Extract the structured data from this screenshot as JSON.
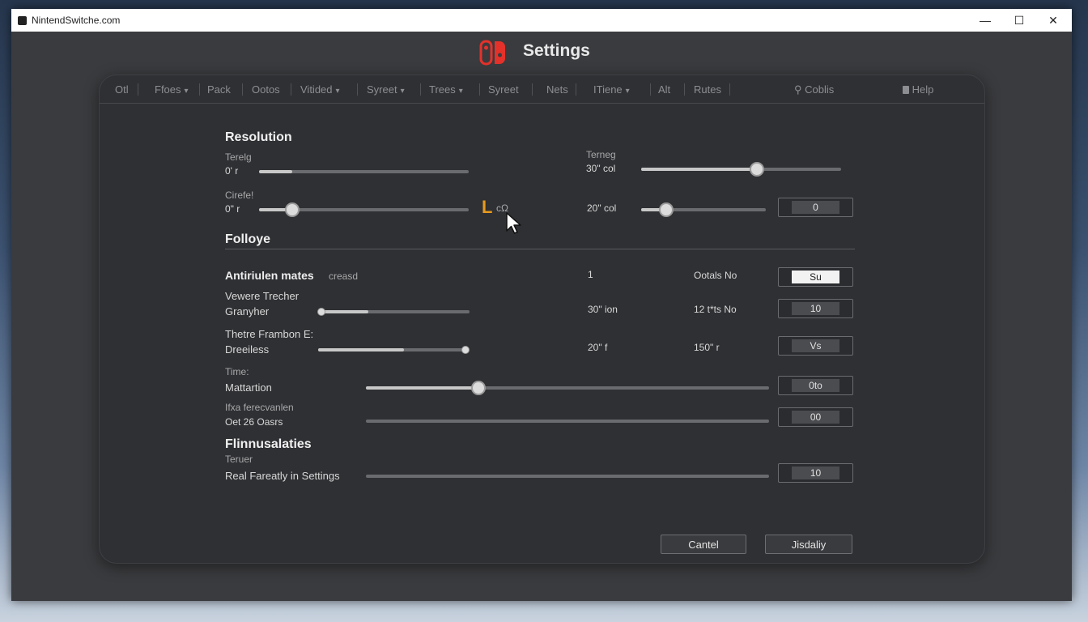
{
  "window": {
    "title": "NintendSwitche.com",
    "controls": [
      "—",
      "☐",
      "✕"
    ]
  },
  "header": {
    "title": "Settings",
    "logo_colors": [
      "#e4322b",
      "#e4322b"
    ]
  },
  "tabs": [
    {
      "label": "Otl",
      "chevron": false
    },
    {
      "label": "Ffoes",
      "chevron": true
    },
    {
      "label": "Pack",
      "chevron": false
    },
    {
      "label": "Ootos",
      "chevron": false
    },
    {
      "label": "Vitided",
      "chevron": true
    },
    {
      "label": "Syreet",
      "chevron": true
    },
    {
      "label": "Trees",
      "chevron": true
    },
    {
      "label": "Syreet",
      "chevron": false
    },
    {
      "label": "Nets",
      "chevron": false
    },
    {
      "label": "ITiene",
      "chevron": true
    },
    {
      "label": "Alt",
      "chevron": false
    },
    {
      "label": "Rutes",
      "chevron": false
    }
  ],
  "search": {
    "icon": "search-icon",
    "label": "Coblis"
  },
  "help": {
    "icon": "book-icon",
    "label": "Help"
  },
  "resolution": {
    "title": "Resolution",
    "row1": {
      "label_top": "Terelg",
      "label_bottom": "0' r",
      "slider_value": 0.16
    },
    "row1_right": {
      "label_top": "Terneg",
      "label_bottom": "30\" col",
      "slider_value": 0.58
    },
    "row2": {
      "label_top": "Cirefe!",
      "label_bottom": "0\" r",
      "slider_value": 0.16,
      "glyph": "L",
      "glyph_after": "cΩ"
    },
    "row2_right": {
      "label": "20\" col",
      "slider_value": 0.2,
      "box_value": "0"
    }
  },
  "folloye": {
    "title": "Folloye",
    "rows": [
      {
        "label": "Antiriulen mates",
        "sublabel": "creasd",
        "col1": "1",
        "col2": "Ootals No",
        "box": "Su",
        "box_white": true
      },
      {
        "label_top": "Vewere Trecher",
        "label_bottom": "Granyher",
        "slider_value": 0.33,
        "col1": "30\" ion",
        "col2": "12 t*ts No",
        "box": "10"
      },
      {
        "label_top": "Thetre Frambon E:",
        "label_bottom": "Dreeiless",
        "slider_value": 0.58,
        "col1": "20\" f",
        "col2": "150\" r",
        "box": "Vs"
      },
      {
        "label_top": "Time:",
        "label_bottom": "Mattartion",
        "slider_value": 0.28,
        "box": "0to"
      },
      {
        "label_top": "Ifxa ferecvanlen",
        "label_bottom": "Oet 26 Oasrs",
        "slider_value": 0.0,
        "box": "00"
      }
    ]
  },
  "flinnusalaties": {
    "title": "Flinnusalaties",
    "row": {
      "label_top": "Teruer",
      "label_bottom": "Real Fareatly in Settings",
      "slider_value": 0.0,
      "box": "10"
    }
  },
  "buttons": {
    "cancel": "Cantel",
    "apply": "Jisdaliy"
  }
}
